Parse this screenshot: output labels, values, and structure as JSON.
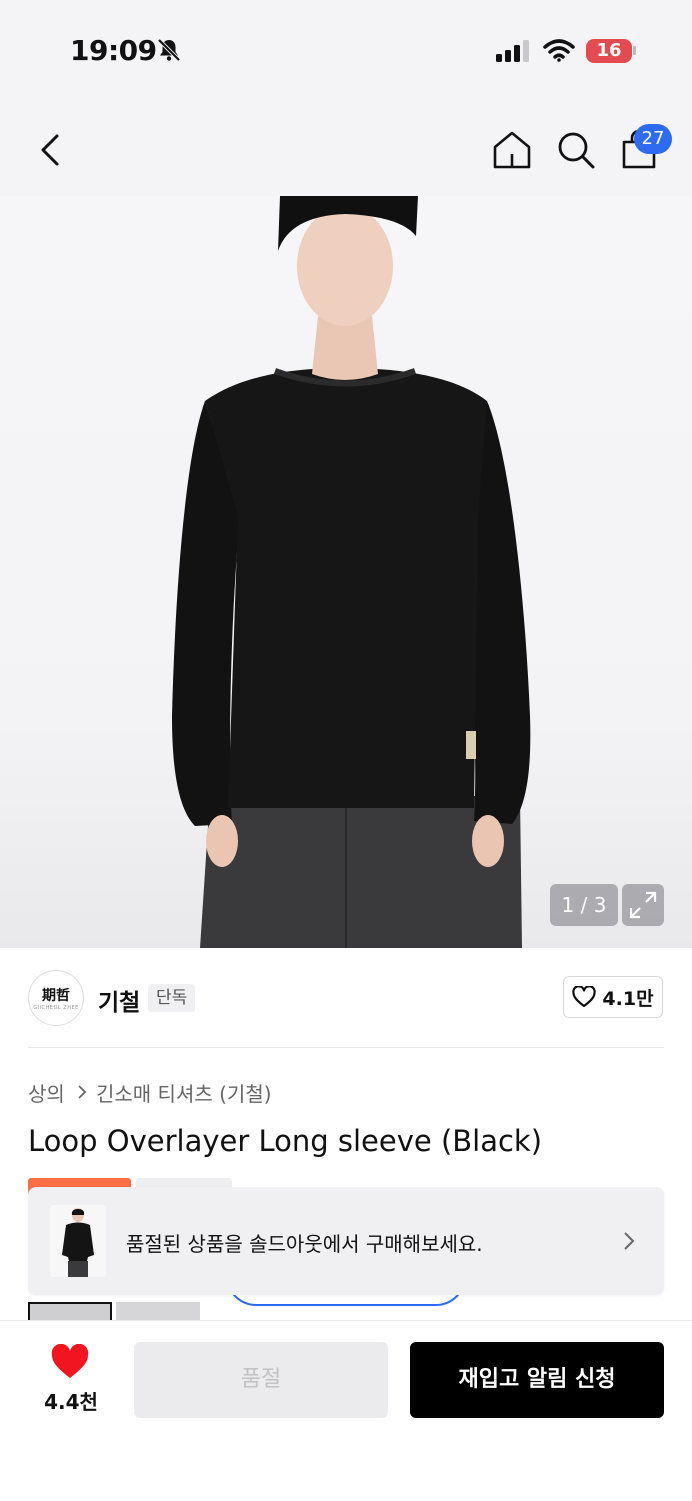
{
  "status_bar": {
    "time": "19:09",
    "battery": "16"
  },
  "header": {
    "cart_count": "27"
  },
  "gallery": {
    "counter": "1 / 3",
    "current": 1,
    "total": 3
  },
  "brand": {
    "name": "기철",
    "badge": "단독",
    "logo_text": "期哲",
    "logo_subtext": "GIICHEOL ZHEE",
    "likes": "4.1만"
  },
  "breadcrumb": {
    "category": "상의",
    "subcategory": "긴소매 티셔츠 (기철)"
  },
  "product": {
    "title": "Loop Overlayer Long sleeve (Black)"
  },
  "toast": {
    "message": "품절된 상품을 솔드아웃에서 구매해보세요."
  },
  "bottom_bar": {
    "wish_count": "4.4천",
    "soldout_label": "품절",
    "restock_label": "재입고 알림 신청"
  },
  "colors": {
    "accent_blue": "#2d6bf0",
    "heart_red": "#f2141e",
    "tag_orange": "#ff6f45",
    "battery_red": "#e44b50"
  }
}
